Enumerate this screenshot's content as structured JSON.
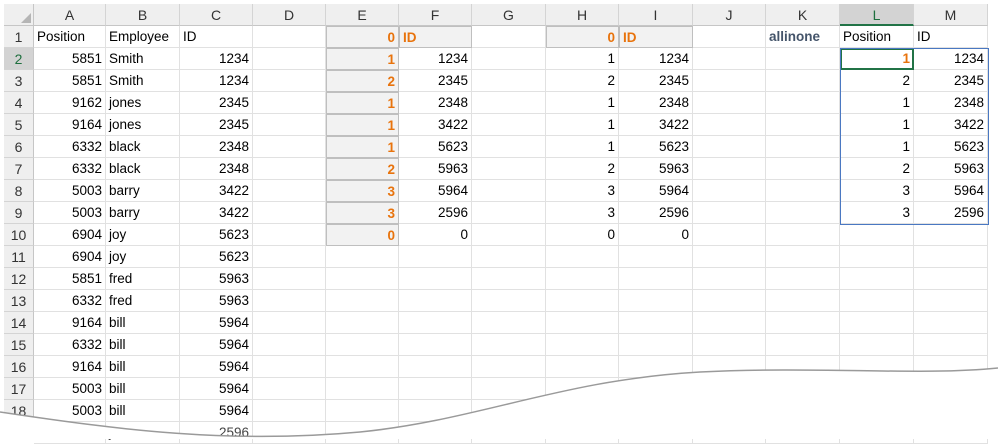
{
  "columns": [
    "A",
    "B",
    "C",
    "D",
    "E",
    "F",
    "G",
    "H",
    "I",
    "J",
    "K",
    "L",
    "M"
  ],
  "rows": [
    "1",
    "2",
    "3",
    "4",
    "5",
    "6",
    "7",
    "8",
    "9",
    "10",
    "11",
    "12",
    "13",
    "14",
    "15",
    "16",
    "17",
    "18"
  ],
  "cells": {
    "A": [
      "Position",
      "5851",
      "5851",
      "9162",
      "9164",
      "6332",
      "6332",
      "5003",
      "5003",
      "6904",
      "6904",
      "5851",
      "6332",
      "9164",
      "6332",
      "9164",
      "5003",
      "5003"
    ],
    "B": [
      "Employee",
      "Smith",
      "Smith",
      "jones",
      "jones",
      "black",
      "black",
      "barry",
      "barry",
      "joy",
      "joy",
      "fred",
      "fred",
      "bill",
      "bill",
      "bill",
      "bill",
      "bill"
    ],
    "C": [
      "ID",
      "1234",
      "1234",
      "2345",
      "2345",
      "2348",
      "2348",
      "3422",
      "3422",
      "5623",
      "5623",
      "5963",
      "5963",
      "5964",
      "5964",
      "5964",
      "5964",
      "5964"
    ],
    "E": [
      "0",
      "1",
      "2",
      "1",
      "1",
      "1",
      "2",
      "3",
      "3",
      "0"
    ],
    "F": [
      "ID",
      "1234",
      "2345",
      "2348",
      "3422",
      "5623",
      "5963",
      "5964",
      "2596",
      "0"
    ],
    "H": [
      "0",
      "1",
      "2",
      "1",
      "1",
      "1",
      "2",
      "3",
      "3",
      "0"
    ],
    "I": [
      "ID",
      "1234",
      "2345",
      "2348",
      "3422",
      "5623",
      "5963",
      "5964",
      "2596",
      "0"
    ],
    "K": [
      "allinone"
    ],
    "L": [
      "Position",
      "1",
      "2",
      "1",
      "1",
      "1",
      "2",
      "3",
      "3"
    ],
    "M": [
      "ID",
      "1234",
      "2345",
      "2348",
      "3422",
      "5623",
      "5963",
      "5964",
      "2596"
    ]
  },
  "partial_row_19": {
    "A": "....",
    "B": "joe",
    "C": "2596"
  },
  "selected": {
    "column": "L",
    "row": "2"
  },
  "colors": {
    "accent_green": "#217346",
    "orange": "#e8730c",
    "range_blue": "#4a78c2",
    "allinone_text": "#44546a"
  }
}
